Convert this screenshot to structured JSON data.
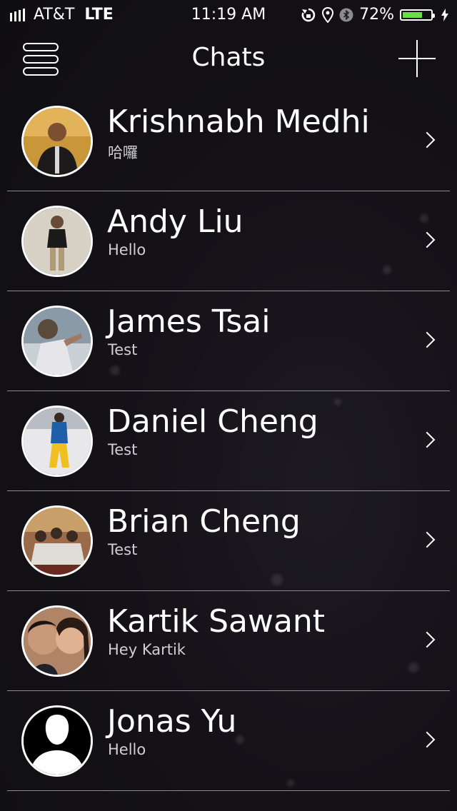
{
  "status_bar": {
    "carrier": "AT&T",
    "network": "LTE",
    "time": "11:19 AM",
    "battery_percent": "72%",
    "battery_level": 0.72,
    "icons": [
      "signal-icon",
      "rotation-lock-icon",
      "location-icon",
      "bluetooth-icon",
      "battery-icon",
      "charging-icon"
    ]
  },
  "nav": {
    "title": "Chats",
    "menu_icon": "menu-icon",
    "add_icon": "add-icon"
  },
  "chats": [
    {
      "name": "Krishnabh Medhi",
      "preview": "哈囉",
      "avatar_color": "#c9973a"
    },
    {
      "name": "Andy Liu",
      "preview": "Hello",
      "avatar_color": "#d8d2c6"
    },
    {
      "name": "James Tsai",
      "preview": "Test",
      "avatar_color": "#8a9aa6"
    },
    {
      "name": "Daniel Cheng",
      "preview": "Test",
      "avatar_color": "#e8e8ea"
    },
    {
      "name": "Brian Cheng",
      "preview": "Test",
      "avatar_color": "#9a6a4a"
    },
    {
      "name": "Kartik Sawant",
      "preview": "Hey Kartik",
      "avatar_color": "#b08466"
    },
    {
      "name": "Jonas Yu",
      "preview": "Hello",
      "avatar_color": "#000000"
    }
  ],
  "colors": {
    "background": "#141217",
    "divider": "#8b8b8f",
    "battery_fill": "#6ddc4b",
    "text": "#ffffff"
  }
}
